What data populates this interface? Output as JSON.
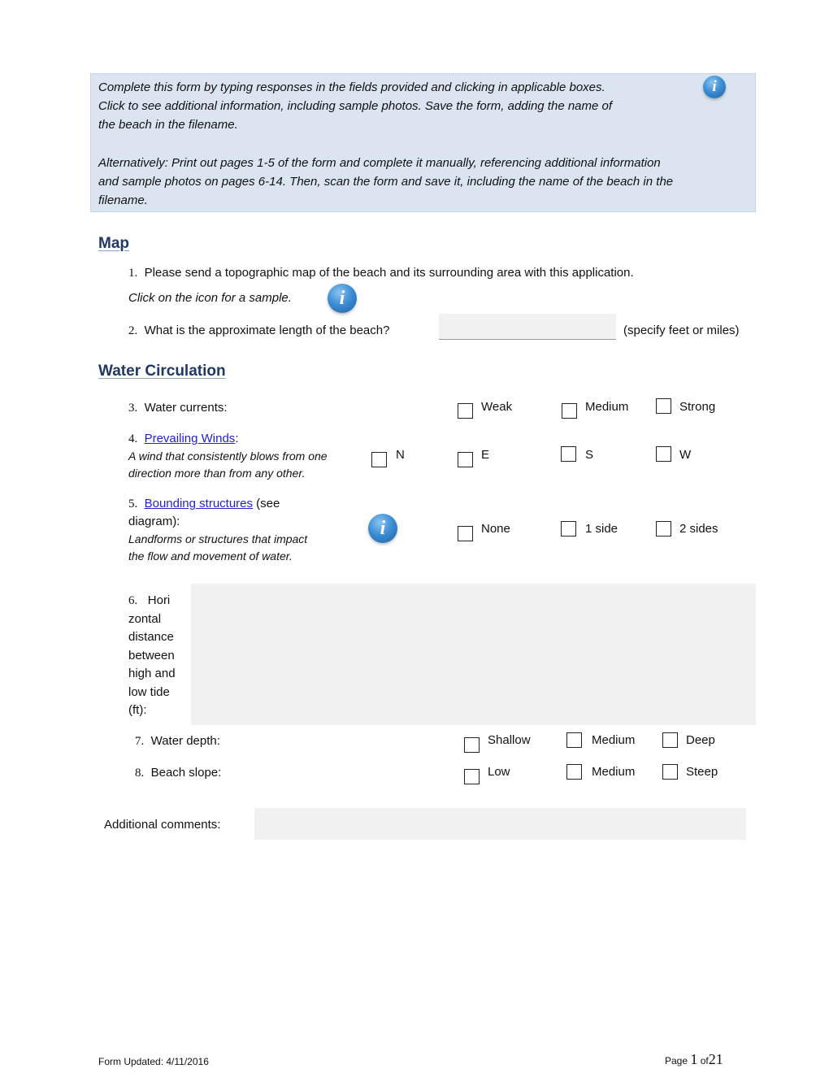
{
  "instructions": {
    "para1": "Complete this form by typing responses in the fields provided and clicking in applicable boxes. Click to see additional information, including sample photos. Save the form, adding the name of the beach in the filename.",
    "para1_line1": "Complete this form by typing responses in the fields provided and clicking in applicable boxes.",
    "para1_line2": "Click to see additional information, including sample photos. Save the form, adding the name of",
    "para1_line3": "the beach in the filename.",
    "para2_line1": "Alternatively: Print out pages 1-5 of the form and complete it manually, referencing additional information",
    "para2_line2": "and sample photos on pages 6-14. Then, scan the form and save it, including the name of the beach in the",
    "para2_line3": "filename.",
    "info_icon": "info-icon"
  },
  "sections": {
    "map": {
      "heading": "Map",
      "q1": {
        "number": "1.",
        "text": "Please send a topographic map of the beach and its surrounding area with this application.",
        "note": "Click on the icon for a sample."
      },
      "q2": {
        "number": "2.",
        "text": "What is the approximate length of the beach?",
        "value": "",
        "suffix": "(specify feet or miles)"
      }
    },
    "water_circulation": {
      "heading": "Water Circulation",
      "q3": {
        "number": "3.",
        "text": "Water currents:",
        "options": [
          "Weak",
          "Medium",
          "Strong"
        ]
      },
      "q4": {
        "number": "4.",
        "link": "Prevailing Winds",
        "colon": ":",
        "note_line1": "A wind that consistently blows from one",
        "note_line2": "direction more than from any other.",
        "options": [
          "N",
          "E",
          "S",
          "W"
        ]
      },
      "q5": {
        "number": "5.",
        "link": "Bounding structures",
        "after_link": " (see",
        "line2": "diagram):",
        "note_line1": "Landforms or structures that impact",
        "note_line2": "the flow and movement of water.",
        "options": [
          "None",
          "1 side",
          "2 sides"
        ]
      },
      "q6": {
        "number": "6.",
        "lines": [
          "Hori",
          "zontal",
          "distance",
          "between",
          "high and",
          "low tide",
          "(ft):"
        ],
        "value": ""
      },
      "q7": {
        "number": "7.",
        "text": "Water depth:",
        "options": [
          "Shallow",
          "Medium",
          "Deep"
        ]
      },
      "q8": {
        "number": "8.",
        "text": "Beach slope:",
        "options": [
          "Low",
          "Medium",
          "Steep"
        ]
      },
      "comments": {
        "label": "Additional comments:",
        "value": ""
      }
    }
  },
  "footer": {
    "updated": "Form Updated: 4/11/2016",
    "page_word": "Page",
    "page_current": "1",
    "of_word": "of",
    "page_total": "21"
  },
  "colors": {
    "info_box_bg": "#dbe5f1",
    "heading": "#1f3864",
    "link": "#1f1fd6",
    "field_bg": "#f1f1f1"
  }
}
